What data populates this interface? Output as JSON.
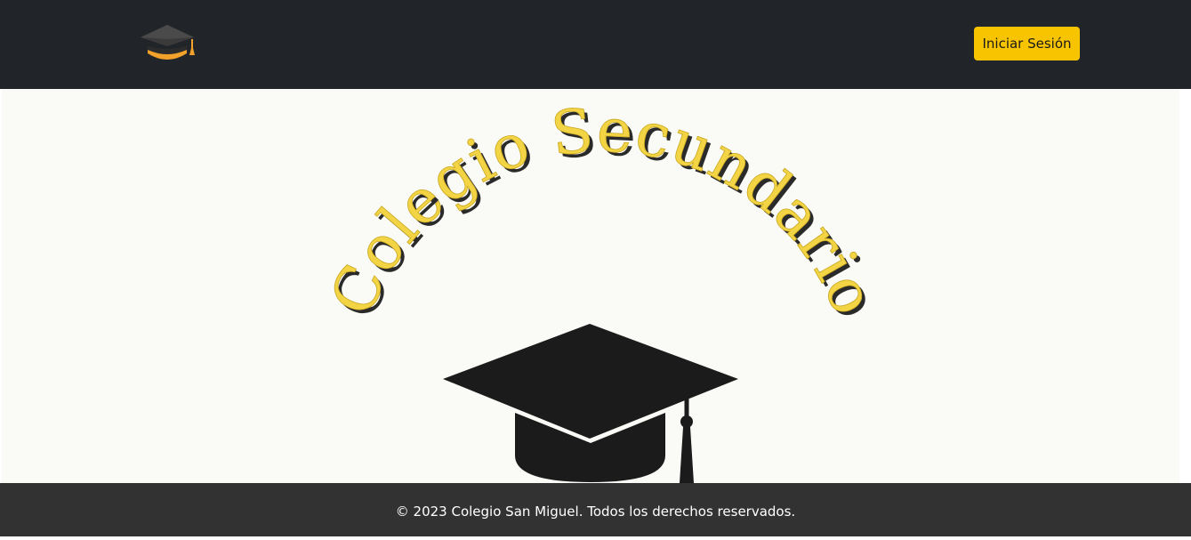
{
  "navbar": {
    "logo_icon": "graduation-cap-icon",
    "login_label": "Iniciar Sesión"
  },
  "hero": {
    "arc_text": "Colegio Secundario",
    "image_icon": "graduation-cap-icon",
    "colors": {
      "text_fill": "#f2d445",
      "text_shadow": "#2a2a2a",
      "cap": "#1b1b1b"
    }
  },
  "footer": {
    "text": "© 2023 Colegio San Miguel. Todos los derechos reservados."
  },
  "colors": {
    "navbar_bg": "#212529",
    "button_bg": "#f8c400",
    "hero_bg": "#fafaf6",
    "footer_bg": "#323232"
  }
}
